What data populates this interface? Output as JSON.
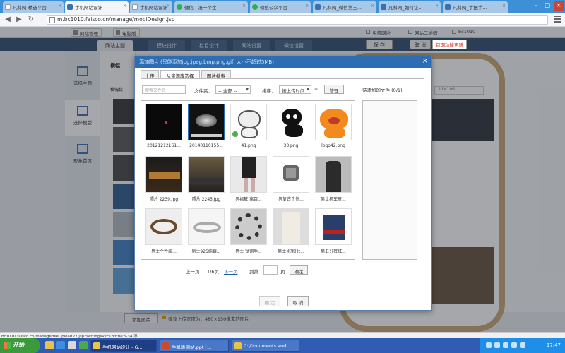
{
  "browser": {
    "tabs": [
      {
        "label": "凡科网-精选平台",
        "favicon": "white",
        "active": false
      },
      {
        "label": "手机网站设计",
        "favicon": "blue",
        "active": true
      },
      {
        "label": "手机网站设计",
        "favicon": "white",
        "active": false
      },
      {
        "label": "微信 - 凑一个生",
        "favicon": "green",
        "active": false
      },
      {
        "label": "微信公众平台",
        "favicon": "green",
        "active": false
      },
      {
        "label": "凡科网_微信第三...",
        "favicon": "blue",
        "active": false
      },
      {
        "label": "凡科网_如何让...",
        "favicon": "blue",
        "active": false
      },
      {
        "label": "凡科网_手把手...",
        "favicon": "blue",
        "active": false
      }
    ],
    "url": "m.bc1010.faisco.cn/manage/mobiDesign.jsp"
  },
  "apptop": {
    "manage_btn": "网站管理",
    "pc_btn": "电脑版",
    "free_domain": "免费网址",
    "qrcode": "网站二维码",
    "account": "bc1010"
  },
  "appnav": {
    "tabs": [
      "网站主题",
      "模块设计",
      "栏目设计",
      "网站设置",
      "微信设置"
    ],
    "save": "保 存",
    "cancel": "取 消"
  },
  "tooltip": "首期功能更新",
  "leftnav": [
    {
      "label": "选择主题",
      "icon": "grid-icon",
      "active": false
    },
    {
      "label": "选择模版",
      "icon": "image-icon",
      "active": true
    },
    {
      "label": "形象首页",
      "icon": "page-icon",
      "active": false
    }
  ],
  "leftpanel": {
    "label1": "横幅",
    "label2": "横幅数"
  },
  "side_input": "id=106",
  "dialog": {
    "title": "添加图片",
    "hint": "(只能添加jpg,jpeg,bmp,png,gif, 大小不超过5MB)",
    "tabs": [
      "上传",
      "从资源库选择",
      "图片搜索"
    ],
    "active_tab": 1,
    "search_placeholder": "搜索文件名",
    "folder_label": "文件夹：",
    "folder_value": "-- 全部 --",
    "sort_label": "排序：",
    "sort_value": "按上传时间",
    "manage_btn": "管理",
    "pending_title": "待添加的文件 (0/1)",
    "images": [
      {
        "caption": "20121212161...",
        "kind": "dark"
      },
      {
        "caption": "20140110155...",
        "kind": "dark2"
      },
      {
        "caption": "41.png",
        "kind": "cat1"
      },
      {
        "caption": "33.png",
        "kind": "cat2"
      },
      {
        "caption": "logo42.png",
        "kind": "cat3"
      },
      {
        "caption": "照片 2239.jpg",
        "kind": "photo1"
      },
      {
        "caption": "照片 2245.jpg",
        "kind": "photo2"
      },
      {
        "caption": "男裙裤 寓百...",
        "kind": "photo3"
      },
      {
        "caption": "男复古个性...",
        "kind": "photo4"
      },
      {
        "caption": "男士机车皮...",
        "kind": "photo5"
      },
      {
        "caption": "男士个性船...",
        "kind": "photo6"
      },
      {
        "caption": "男士925纯银...",
        "kind": "photo7"
      },
      {
        "caption": "男士 钛钢手...",
        "kind": "photo8"
      },
      {
        "caption": "男士 纽扣七...",
        "kind": "photo9"
      },
      {
        "caption": "男五分裤红...",
        "kind": "photo10"
      }
    ],
    "pager": {
      "prev": "上一页",
      "page": "1/6页",
      "next": "下一页",
      "jump": "到第",
      "unit": "页",
      "confirm": "确定"
    },
    "ok": "确 定",
    "cancel": "取 消"
  },
  "bottom": {
    "add_btn": "添加图片",
    "tip": "建议上传宽度为：480×150像素的图片"
  },
  "status_text": "bc1010.faisco.cn/manage/fileUploadV2.jsp?settingsV?ETB'title'%3A'添...",
  "taskbar": {
    "start": "开始",
    "tasks": [
      "手机网站设计 - G...",
      "手机版网站.ppt [...",
      "C:\\Documents and..."
    ],
    "clock": "17:47"
  }
}
